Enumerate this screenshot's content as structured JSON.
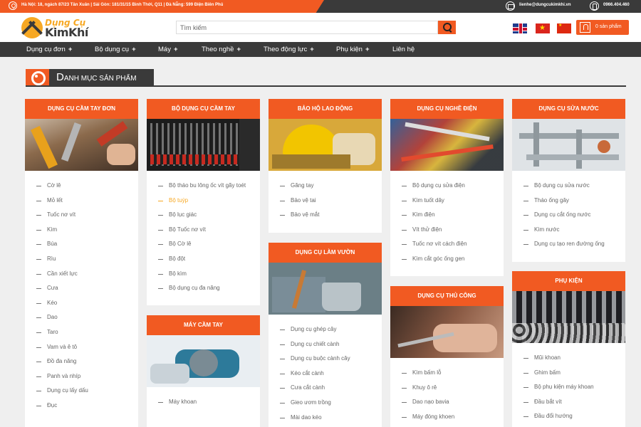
{
  "topbar": {
    "address": "Hà Nội: 18, ngách 87/23 Tân Xuân | Sài Gòn: 181/31/15 Bình Thới, Q11 | Đà Nẵng: 599 Điện Biên Phủ",
    "email": "lienhe@dungcukimkhi.vn",
    "phone": "0966.404.460"
  },
  "header": {
    "logo_line1": "Dụng Cụ",
    "logo_line2": "KimKhí",
    "search_placeholder": "Tìm kiếm",
    "cart_label": "0 sản phẩm"
  },
  "nav": [
    {
      "label": "Dụng cụ đơn",
      "plus": "+"
    },
    {
      "label": "Bộ dụng cụ",
      "plus": "+"
    },
    {
      "label": "Máy",
      "plus": "+"
    },
    {
      "label": "Theo nghề",
      "plus": "+"
    },
    {
      "label": "Theo động lực",
      "plus": "+"
    },
    {
      "label": "Phụ kiện",
      "plus": "+"
    },
    {
      "label": "Liên hệ",
      "plus": ""
    }
  ],
  "section": {
    "title_first": "D",
    "title_rest": "ANH MỤC SẢN PHẨM"
  },
  "cards": [
    {
      "title": "Dụng cụ cầm tay đơn",
      "items": [
        "Cờ lê",
        "Mỏ lết",
        "Tuốc nơ vít",
        "Kìm",
        "Búa",
        "Rìu",
        "Cần xiết lực",
        "Cưa",
        "Kéo",
        "Dao",
        "Taro",
        "Vam và ê tô",
        "Đồ đa năng",
        "Panh và nhíp",
        "Dụng cụ lấy dấu",
        "Đục"
      ]
    },
    {
      "title": "Bộ dụng cụ cầm tay",
      "items": [
        "Bộ tháo bu lông ốc vít gãy toét",
        "Bộ tuýp",
        "Bộ lục giác",
        "Bộ Tuốc nơ vít",
        "Bộ Cờ lê",
        "Bộ đột",
        "Bộ kìm",
        "Bộ dụng cụ đa năng"
      ]
    },
    {
      "title": "Máy cầm tay",
      "items": [
        "Máy khoan"
      ]
    },
    {
      "title": "Bảo hộ lao động",
      "items": [
        "Găng tay",
        "Bảo vệ tai",
        "Bảo vệ mắt"
      ]
    },
    {
      "title": "Dụng cụ làm vườn",
      "items": [
        "Dụng cụ ghép cây",
        "Dụng cụ chiết cành",
        "Dụng cụ buộc cành cây",
        "Kéo cắt cành",
        "Cưa cắt cành",
        "Gieo ươm trồng",
        "Mài dao kéo"
      ]
    },
    {
      "title": "Dụng cụ nghề điện",
      "items": [
        "Bộ dụng cụ sửa điện",
        "Kìm tuốt dây",
        "Kìm điện",
        "Vít thử điện",
        "Tuốc nơ vít cách điện",
        "Kìm cắt góc ống gen"
      ]
    },
    {
      "title": "Dụng cụ thủ công",
      "items": [
        "Kìm bấm lỗ",
        "Khuy ô rê",
        "Dao nạo bavia",
        "Máy đóng khoen"
      ]
    },
    {
      "title": "Dụng cụ sửa nước",
      "items": [
        "Bộ dụng cụ sửa nước",
        "Tháo ống gây",
        "Dụng cụ cắt ống nước",
        "Kìm nước",
        "Dụng cụ tạo ren đường ống"
      ]
    },
    {
      "title": "Phụ kiện",
      "items": [
        "Mũi khoan",
        "Ghim bấm",
        "Bộ phụ kiện máy khoan",
        "Đầu bắt vít",
        "Đầu đổi hướng"
      ]
    }
  ]
}
